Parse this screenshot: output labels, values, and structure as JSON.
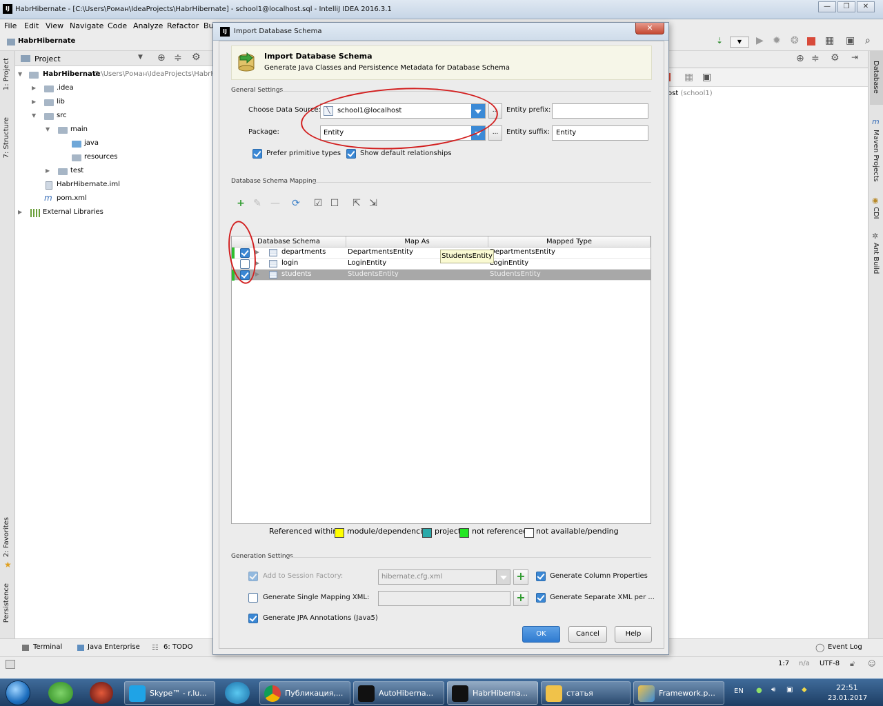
{
  "window": {
    "title": "HabrHibernate - [C:\\Users\\Роман\\IdeaProjects\\HabrHibernate] - school1@localhost.sql - IntelliJ IDEA 2016.3.1",
    "controls": [
      "—",
      "❐",
      "✕"
    ]
  },
  "menu": [
    "File",
    "Edit",
    "View",
    "Navigate",
    "Code",
    "Analyze",
    "Refactor",
    "Bu"
  ],
  "nav": {
    "crumb": "HabrHibernate"
  },
  "project_panel": {
    "header": "Project",
    "tree": [
      {
        "label": "HabrHibernate",
        "path": "C:\\Users\\Роман\\IdeaProjects\\HabrH"
      },
      {
        "label": ".idea"
      },
      {
        "label": "lib"
      },
      {
        "label": "src"
      },
      {
        "label": "main"
      },
      {
        "label": "java"
      },
      {
        "label": "resources"
      },
      {
        "label": "test"
      },
      {
        "label": "HabrHibernate.iml"
      },
      {
        "label": "pom.xml"
      },
      {
        "label": "External Libraries"
      }
    ]
  },
  "left_tools": [
    "1: Project",
    "7: Structure",
    "2: Favorites",
    "Persistence"
  ],
  "right_tools": [
    "Database",
    "Maven Projects",
    "CDI",
    "Ant Build"
  ],
  "right_panel": {
    "host": "ost",
    "host_sub": "(school1)"
  },
  "bottom_tools": [
    "Terminal",
    "Java Enterprise",
    "6: TODO"
  ],
  "event_log": "Event Log",
  "status": {
    "position": "1:7",
    "na": "n/a",
    "encoding": "UTF-8"
  },
  "dialog": {
    "title": "Import Database Schema",
    "banner_title": "Import Database Schema",
    "banner_subtitle": "Generate Java Classes and Persistence Metadata for Database Schema",
    "general_settings": "General Settings",
    "data_source_label": "Choose Data Source:",
    "data_source_value": "school1@localhost",
    "package_label": "Package:",
    "package_value": "Entity",
    "ellipsis": "...",
    "entity_prefix_label": "Entity prefix:",
    "entity_prefix_value": "",
    "entity_suffix_label": "Entity suffix:",
    "entity_suffix_value": "Entity",
    "prefer_primitive": "Prefer primitive types",
    "show_relationships": "Show default relationships",
    "mapping_section": "Database Schema Mapping",
    "columns": [
      "Database Schema",
      "Map As",
      "Mapped Type"
    ],
    "rows": [
      {
        "schema": "departments",
        "map_as": "DepartmentsEntity",
        "mapped": "DepartmentsEntity",
        "checked": true
      },
      {
        "schema": "login",
        "map_as": "LoginEntity",
        "mapped": "LoginEntity",
        "checked": false
      },
      {
        "schema": "students",
        "map_as": "StudentsEntity",
        "mapped": "StudentsEntity",
        "checked": true
      }
    ],
    "tooltip": "StudentsEntity",
    "legend_prefix": "Referenced within:",
    "legend": [
      {
        "label": "module/dependencies",
        "color": "#ffff00"
      },
      {
        "label": "project",
        "color": "#2aa9a9"
      },
      {
        "label": "not referenced",
        "color": "#22e622"
      },
      {
        "label": "not available/pending",
        "color": "#ffffff"
      }
    ],
    "generation_settings": "Generation Settings",
    "add_session_factory": "Add to Session Factory:",
    "session_factory_value": "hibernate.cfg.xml",
    "gen_single_xml": "Generate Single Mapping XML:",
    "gen_jpa": "Generate JPA Annotations (Java5)",
    "gen_column_props": "Generate Column Properties",
    "gen_separate_xml": "Generate Separate XML per ...",
    "ok": "OK",
    "cancel": "Cancel",
    "help": "Help"
  },
  "taskbar": {
    "items": [
      "Skype™ - r.lu...",
      "Публикация,...",
      "AutoHiberna...",
      "HabrHiberna...",
      "статья",
      "Framework.p..."
    ],
    "lang": "EN",
    "time": "22:51",
    "date": "23.01.2017"
  },
  "colors": {
    "accent": "#3a87d4",
    "annotation": "#d21f1f",
    "selected_row": "#a8a8a8",
    "banner": "#f6f6e8"
  }
}
